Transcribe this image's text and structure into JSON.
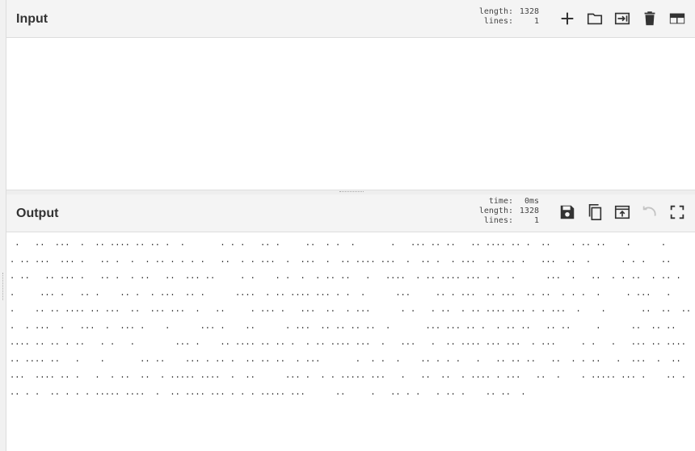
{
  "input": {
    "title": "Input",
    "stats": {
      "length_label": "length:",
      "length_value": "1328",
      "lines_label": "lines:",
      "lines_value": "1"
    },
    "buttons": [
      "add-icon",
      "open-folder-icon",
      "insert-file-icon",
      "delete-icon",
      "layout-icon"
    ],
    "text": ""
  },
  "output": {
    "title": "Output",
    "stats": {
      "time_label": "time:",
      "time_value": "0ms",
      "length_label": "length:",
      "length_value": "1328",
      "lines_label": "lines:",
      "lines_value": "1"
    },
    "buttons": [
      "save-icon",
      "copy-icon",
      "replace-input-icon",
      "undo-icon",
      "maximize-icon"
    ],
    "text": " .   ..  ...  .  .. .... .. .. .  .       . . .   .. .     ..  . .  .       .   ... .. ..   .. .... .. .  ..    . .. ..    .      .      . .. ...  ... .   .. .  .  . .. . . . .   ..  . . ...  .  ...  .  .. .... ...  .  .. .  . ...  .. ... .   ...  ..  .      . . .   ..     . ..   .. ... .   .. .  . ..   ..  ... ..     . .    . .  .  . .. ..   .   ....  . .. .... ... . .  .      ...  .   ..  . . ..  . .. .   .     ... .   .. .    .. .  . ...  .. .      ....  . .. .... ... . .  .      ...     .. . ...  .. ...  .. ..  . . .  .     . ...   .      .    .. .. .... .. ...  ..  ... ...  .   ..     . ... .   ...  ..  . ...      . .   . ..  . .. .... ... . . ...  .    .       ..  ..  .. .  . ...  .   ...  .  ... .    .      ... .    ..      . ...  .. .. .. ..  .       ... ... .. .  . .. ..   .. ..     .      ..  .. .. .... .. .. . ..   . .   .        ... .    .. .... .. .. .  . .. .... ...  .   ...   .  .. .... ... ...  . ...     . .   .   ... .. .... .. .... ..   .    .       .. ..    ... . .. .  .. .. ..  . ...       .  . .  .    .. . . .   .   .. .. ..   ..  . . ..   .  ...  .  .. ...  .... .. .   .  . ..  ..  . ..... ....  .  ..      ... .  . . ..... ...   .   ..  ..  . .... . ...   ..  .    . ..... ... .    .. .     .. . .  .. . . . ..... ....  .  .. .... ... . . . ..... ...      ..     .   .. . .   . .. .    .. ..  ."
  }
}
